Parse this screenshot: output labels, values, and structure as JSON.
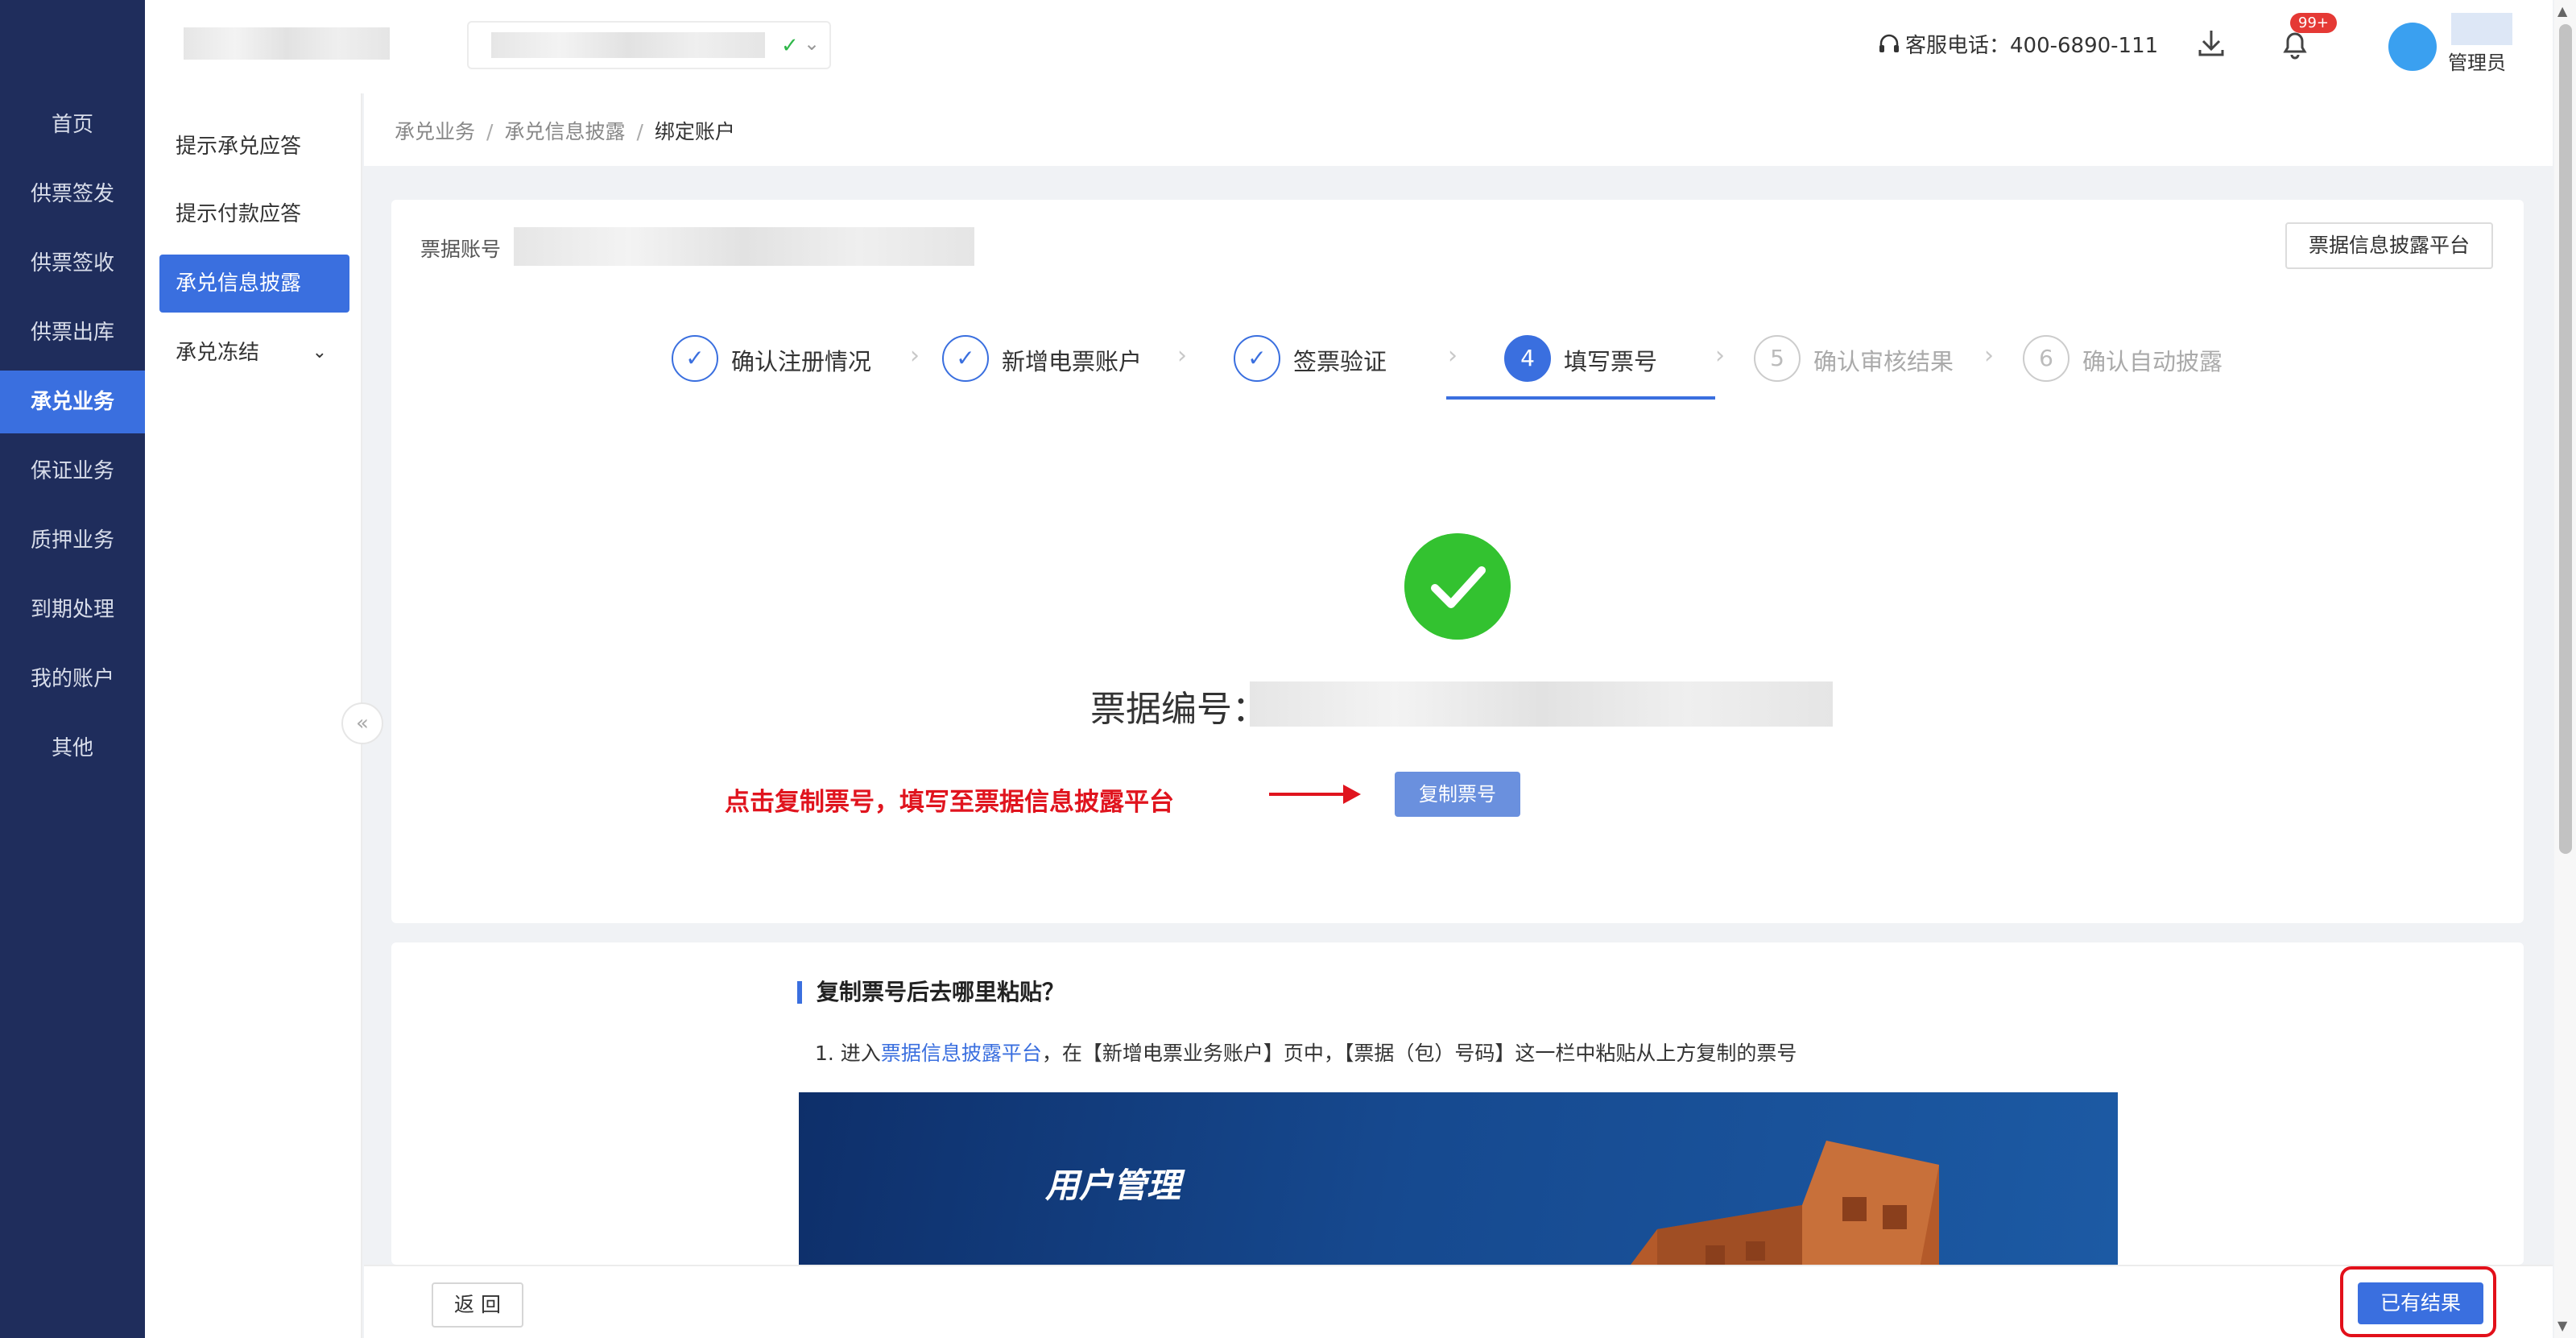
{
  "nav": {
    "items": [
      "首页",
      "供票签发",
      "供票签收",
      "供票出库",
      "承兑业务",
      "保证业务",
      "质押业务",
      "到期处理",
      "我的账户",
      "其他"
    ],
    "active_index": 4
  },
  "header": {
    "service_phone": "客服电话：400-6890-111",
    "notification_badge": "99+",
    "user_role": "管理员"
  },
  "submenu": {
    "items": [
      "提示承兑应答",
      "提示付款应答",
      "承兑信息披露",
      "承兑冻结"
    ],
    "active_index": 2,
    "collapse_glyph": "«"
  },
  "breadcrumb": {
    "items": [
      "承兑业务",
      "承兑信息披露",
      "绑定账户"
    ],
    "separator": "/"
  },
  "main": {
    "account_label": "票据账号",
    "platform_button": "票据信息披露平台",
    "steps": [
      {
        "label": "确认注册情况",
        "state": "done"
      },
      {
        "label": "新增电票账户",
        "state": "done"
      },
      {
        "label": "签票验证",
        "state": "done"
      },
      {
        "label": "填写票号",
        "state": "current",
        "number": "4"
      },
      {
        "label": "确认审核结果",
        "state": "todo",
        "number": "5"
      },
      {
        "label": "确认自动披露",
        "state": "todo",
        "number": "6"
      }
    ],
    "bill_number_label": "票据编号：",
    "hint": "点击复制票号，填写至票据信息披露平台",
    "copy_button": "复制票号"
  },
  "help": {
    "title": "复制票号后去哪里粘贴？",
    "line_prefix": "1. 进入",
    "line_link": "票据信息披露平台",
    "line_suffix": "，在【新增电票业务账户】页中，【票据（包）号码】这一栏中粘贴从上方复制的票号",
    "banner_title": "用户管理"
  },
  "footer": {
    "back_button": "返 回",
    "result_button": "已有结果"
  },
  "colors": {
    "nav_bg": "#1f2d5c",
    "accent": "#3a6fdf",
    "success": "#33c230",
    "alert_red": "#e0141e"
  }
}
